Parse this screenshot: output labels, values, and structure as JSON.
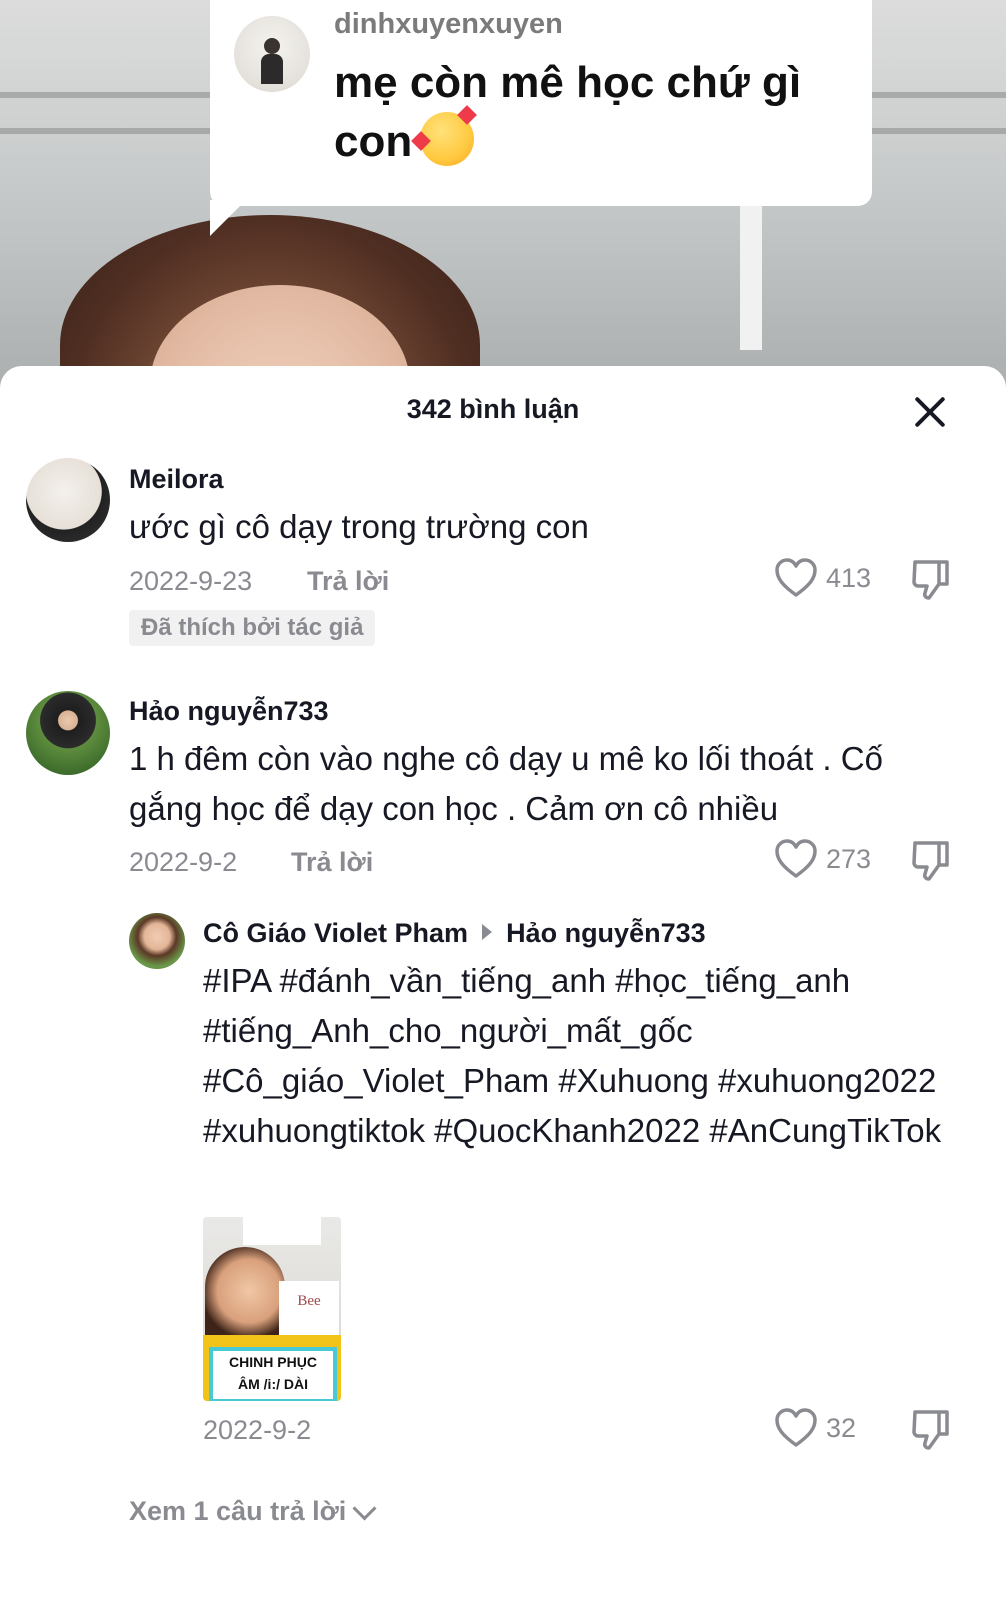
{
  "video": {
    "bubble": {
      "username": "dinhxuyenxuyen",
      "text": "mẹ còn mê học chứ gì con",
      "emoji": "smiling-face-with-hearts-icon"
    }
  },
  "sheet": {
    "title": "342 bình luận"
  },
  "comments": [
    {
      "username": "Meilora",
      "text": "ước gì cô dạy trong trường con",
      "date": "2022-9-23",
      "reply_label": "Trả lời",
      "likes": "413",
      "badge": "Đã thích bởi tác giả"
    },
    {
      "username": "Hảo nguyễn733",
      "text": "1 h đêm còn vào nghe cô dạy u mê ko lối thoát . Cố gắng học để dạy con học . Cảm ơn cô nhiều",
      "date": "2022-9-2",
      "reply_label": "Trả lời",
      "likes": "273",
      "reply": {
        "username": "Cô Giáo Violet Pham",
        "reply_to": "Hảo nguyễn733",
        "text": "#IPA #đánh_vần_tiếng_anh #học_tiếng_anh #tiếng_Anh_cho_người_mất_gốc #Cô_giáo_Violet_Pham #Xuhuong #xuhuong2022 #xuhuongtiktok #QuocKhanh2022 #AnCungTikTok",
        "date": "2022-9-2",
        "likes": "32",
        "thumbnail": {
          "card_word": "Bee",
          "label_line1": "CHINH PHỤC",
          "label_line2": "ÂM /i:/ DÀI"
        }
      },
      "view_replies": "Xem 1 câu trả lời"
    }
  ],
  "colors": {
    "text": "#161823",
    "muted": "#8a8b91",
    "badge_bg": "#f1f1f2"
  }
}
